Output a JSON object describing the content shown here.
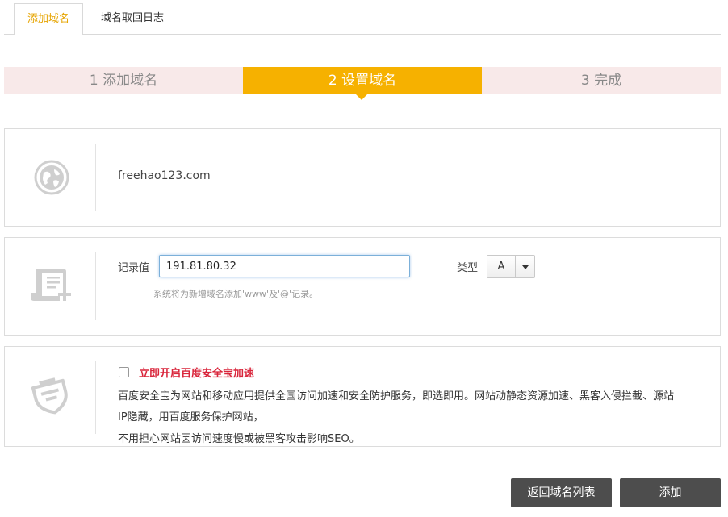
{
  "tabs": {
    "add_domain": "添加域名",
    "retrieve_log": "域名取回日志"
  },
  "steps": {
    "step1": "1 添加域名",
    "step2": "2 设置域名",
    "step3": "3 完成"
  },
  "domain_panel": {
    "icon": "globe-icon",
    "domain": "freehao123.com"
  },
  "record_panel": {
    "icon": "scroll-add-icon",
    "record_label": "记录值",
    "record_value": "191.81.80.32",
    "hint": "系统将为新增域名添加'www'及'@'记录。",
    "type_label": "类型",
    "type_value": "A"
  },
  "accel_panel": {
    "icon": "shield-badge-icon",
    "checkbox_checked": false,
    "label": "立即开启百度安全宝加速",
    "desc_line1": "百度安全宝为网站和移动应用提供全国访问加速和安全防护服务，即选即用。网站动静态资源加速、黑客入侵拦截、源站",
    "desc_line2": "IP隐藏，用百度服务保护网站，",
    "desc_line3": "不用担心网站因访问速度慢或被黑客攻击影响SEO。"
  },
  "buttons": {
    "back": "返回域名列表",
    "add": "添加"
  },
  "colors": {
    "active_tab_text": "#e6a400",
    "active_step_bg": "#f6b100",
    "step_bg": "#f8e9e9",
    "accel_label": "#d9253b",
    "button_bg": "#4d4d4d"
  }
}
